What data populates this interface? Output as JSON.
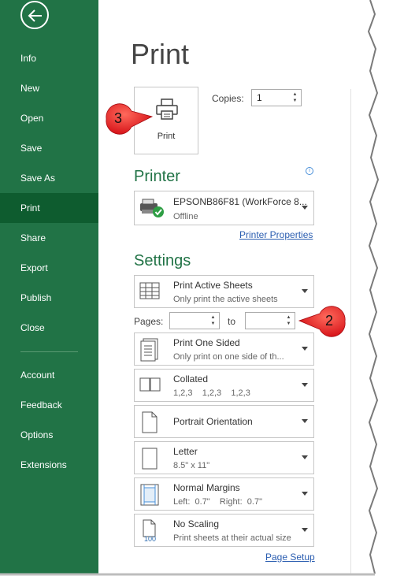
{
  "nav": {
    "items": [
      {
        "label": "Info"
      },
      {
        "label": "New"
      },
      {
        "label": "Open"
      },
      {
        "label": "Save"
      },
      {
        "label": "Save As"
      },
      {
        "label": "Print",
        "active": true
      },
      {
        "label": "Share"
      },
      {
        "label": "Export"
      },
      {
        "label": "Publish"
      },
      {
        "label": "Close"
      },
      {
        "label": "Account"
      },
      {
        "label": "Feedback"
      },
      {
        "label": "Options"
      },
      {
        "label": "Extensions"
      }
    ]
  },
  "page": {
    "title": "Print",
    "print_button_label": "Print",
    "copies_label": "Copies:",
    "copies_value": "1"
  },
  "printer": {
    "section_title": "Printer",
    "name": "EPSONB86F81 (WorkForce 8...",
    "status": "Offline",
    "properties_link": "Printer Properties"
  },
  "settings": {
    "section_title": "Settings",
    "what": {
      "title": "Print Active Sheets",
      "subtitle": "Only print the active sheets"
    },
    "pages_label": "Pages:",
    "to_label": "to",
    "pages_from": "",
    "pages_to": "",
    "sides": {
      "title": "Print One Sided",
      "subtitle": "Only print on one side of th..."
    },
    "collation": {
      "title": "Collated",
      "subtitle": "1,2,3    1,2,3    1,2,3"
    },
    "orientation": {
      "title": "Portrait Orientation"
    },
    "paper": {
      "title": "Letter",
      "subtitle": "8.5\" x 11\""
    },
    "margins": {
      "title": "Normal Margins",
      "subtitle": "Left:  0.7\"    Right:  0.7\""
    },
    "scaling": {
      "title": "No Scaling",
      "subtitle": "Print sheets at their actual size",
      "icon_text": "100"
    },
    "page_setup_link": "Page Setup"
  },
  "callouts": {
    "step_print": "3",
    "step_pages": "2"
  },
  "colors": {
    "nav_bg": "#217346",
    "nav_active": "#0e5c2f",
    "accent": "#217346",
    "callout": "#e8141b",
    "link": "#2a5db0"
  }
}
